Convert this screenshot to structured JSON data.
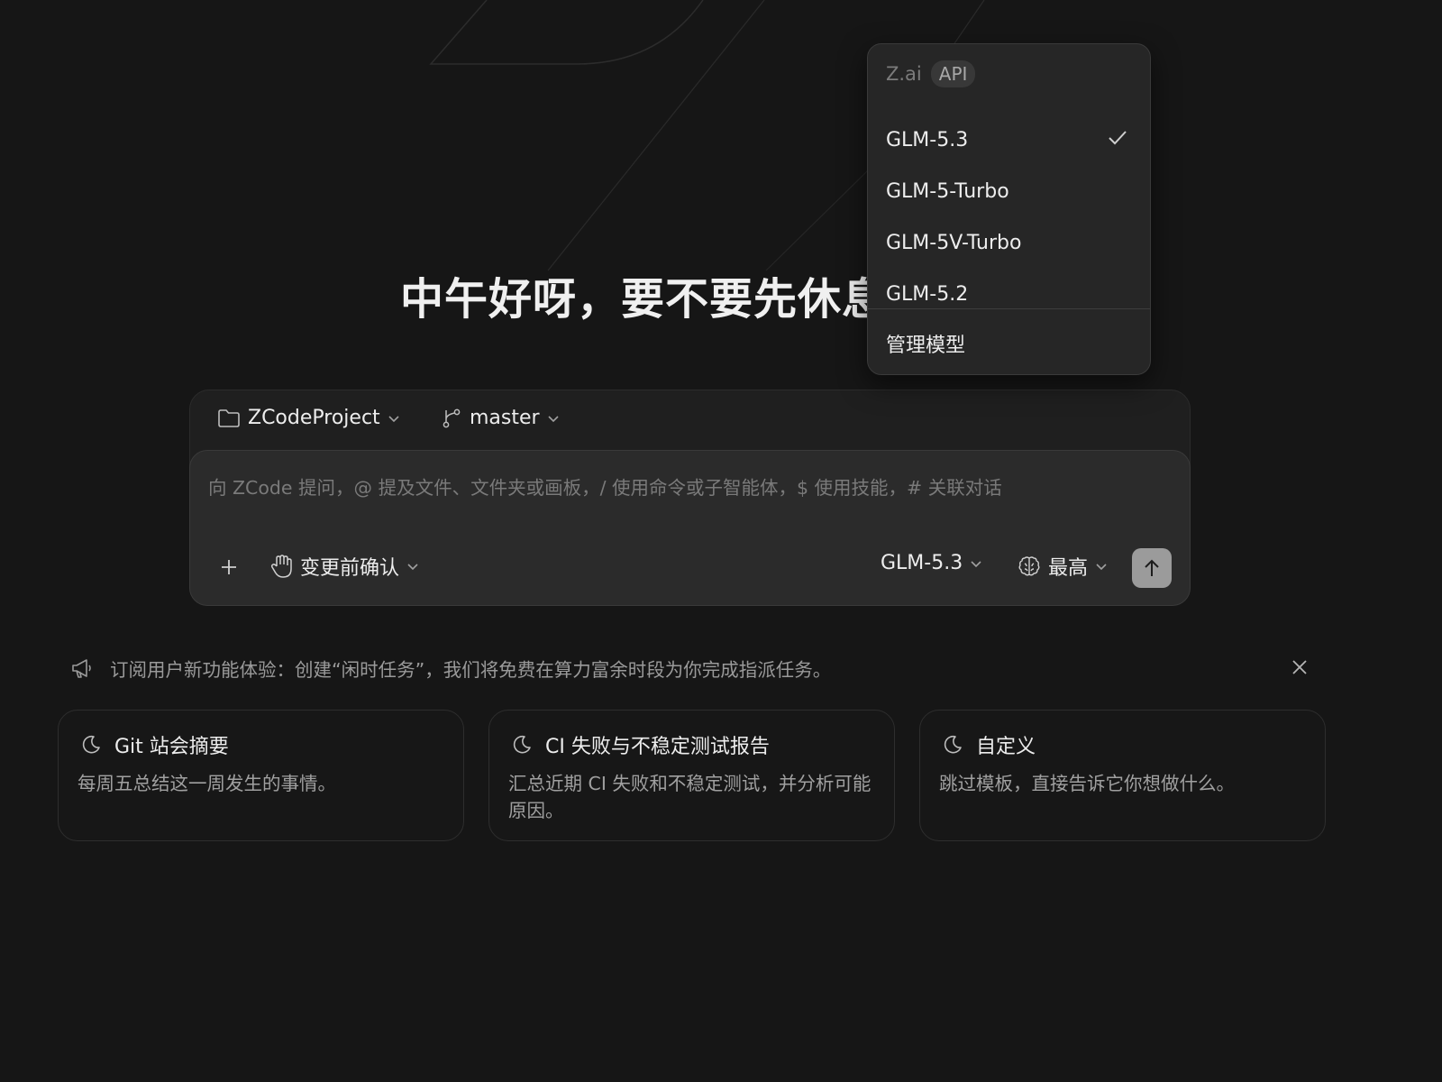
{
  "greeting": "中午好呀，要不要先休息",
  "model_menu": {
    "provider": "Z.ai",
    "provider_badge": "API",
    "items": [
      {
        "label": "GLM-5.3",
        "selected": true
      },
      {
        "label": "GLM-5-Turbo",
        "selected": false
      },
      {
        "label": "GLM-5V-Turbo",
        "selected": false
      },
      {
        "label": "GLM-5.2",
        "selected": false
      }
    ],
    "manage_label": "管理模型"
  },
  "composer": {
    "project": "ZCodeProject",
    "branch": "master",
    "placeholder": "向 ZCode 提问，@ 提及文件、文件夹或画板，/ 使用命令或子智能体，$ 使用技能，# 关联对话",
    "add_icon": "plus-icon",
    "confirm_mode": "变更前确认",
    "model": "GLM-5.3",
    "reasoning": "最高",
    "send_icon": "arrow-up-icon"
  },
  "announcement": {
    "icon": "megaphone-icon",
    "text": "订阅用户新功能体验：创建“闲时任务”，我们将免费在算力富余时段为你完成指派任务。"
  },
  "cards": [
    {
      "icon": "moon-icon",
      "title": "Git 站会摘要",
      "desc": "每周五总结这一周发生的事情。"
    },
    {
      "icon": "moon-icon",
      "title": "CI 失败与不稳定测试报告",
      "desc": "汇总近期 CI 失败和不稳定测试，并分析可能原因。"
    },
    {
      "icon": "moon-icon",
      "title": "自定义",
      "desc": "跳过模板，直接告诉它你想做什么。"
    }
  ],
  "colors": {
    "background": "#161616",
    "composer": "#2b2b2b",
    "send_button": "#9b9b9b"
  }
}
